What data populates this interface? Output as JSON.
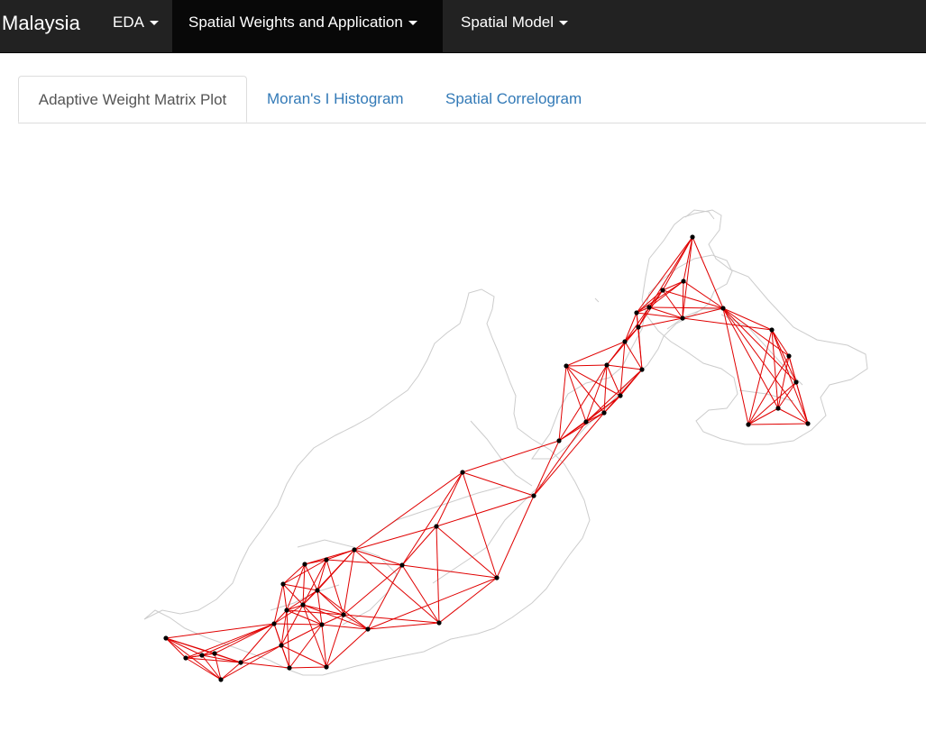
{
  "navbar": {
    "brand": "Malaysia",
    "items": [
      {
        "label": "EDA"
      },
      {
        "label": "Spatial Weights and Application"
      },
      {
        "label": "Spatial Model"
      }
    ]
  },
  "tabs": [
    {
      "label": "Adaptive Weight Matrix Plot"
    },
    {
      "label": "Moran's I Histogram"
    },
    {
      "label": "Spatial Correlogram"
    }
  ],
  "colors": {
    "navbar_bg": "#222222",
    "navbar_active_bg": "#080808",
    "tab_link": "#337ab7",
    "edge": "#e00000",
    "node": "#000000",
    "boundary": "#cccccc"
  },
  "plot": {
    "type": "adaptive-weight-matrix-network",
    "neighbors_per_node_k": 6
  }
}
